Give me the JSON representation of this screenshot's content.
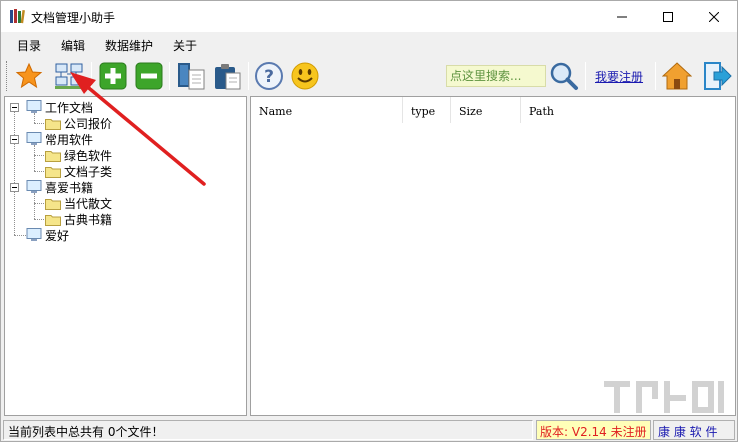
{
  "window": {
    "title": "文档管理小助手"
  },
  "menu": {
    "items": [
      "目录",
      "编辑",
      "数据维护",
      "关于"
    ]
  },
  "toolbar": {
    "icons": [
      "star-icon",
      "network-icon",
      "plus-icon",
      "minus-icon",
      "copy-icon",
      "paste-icon",
      "help-icon",
      "smiley-icon",
      "search-icon",
      "home-icon",
      "exit-icon"
    ],
    "search_placeholder": "点这里搜索...",
    "register_label": "我要注册"
  },
  "tree": {
    "nodes": [
      {
        "label": "工作文档",
        "icon": "computer-icon",
        "children": [
          "公司报价"
        ]
      },
      {
        "label": "常用软件",
        "icon": "computer-icon",
        "children": [
          "绿色软件",
          "文档子类"
        ]
      },
      {
        "label": "喜爱书籍",
        "icon": "computer-icon",
        "children": [
          "当代散文",
          "古典书籍"
        ]
      },
      {
        "label": "爱好",
        "icon": "computer-icon",
        "children": []
      }
    ]
  },
  "list": {
    "columns": [
      "Name",
      "type",
      "Size",
      "Path"
    ],
    "rows": []
  },
  "status": {
    "summary": "当前列表中总共有 0个文件！",
    "version": "版本: V2.14 未注册",
    "brand": "康 康 软 件"
  },
  "colors": {
    "accent_red": "#e02020",
    "link_blue": "#1a1ab0",
    "search_bg": "#f5f9cf",
    "version_bg": "#ffffb8"
  }
}
